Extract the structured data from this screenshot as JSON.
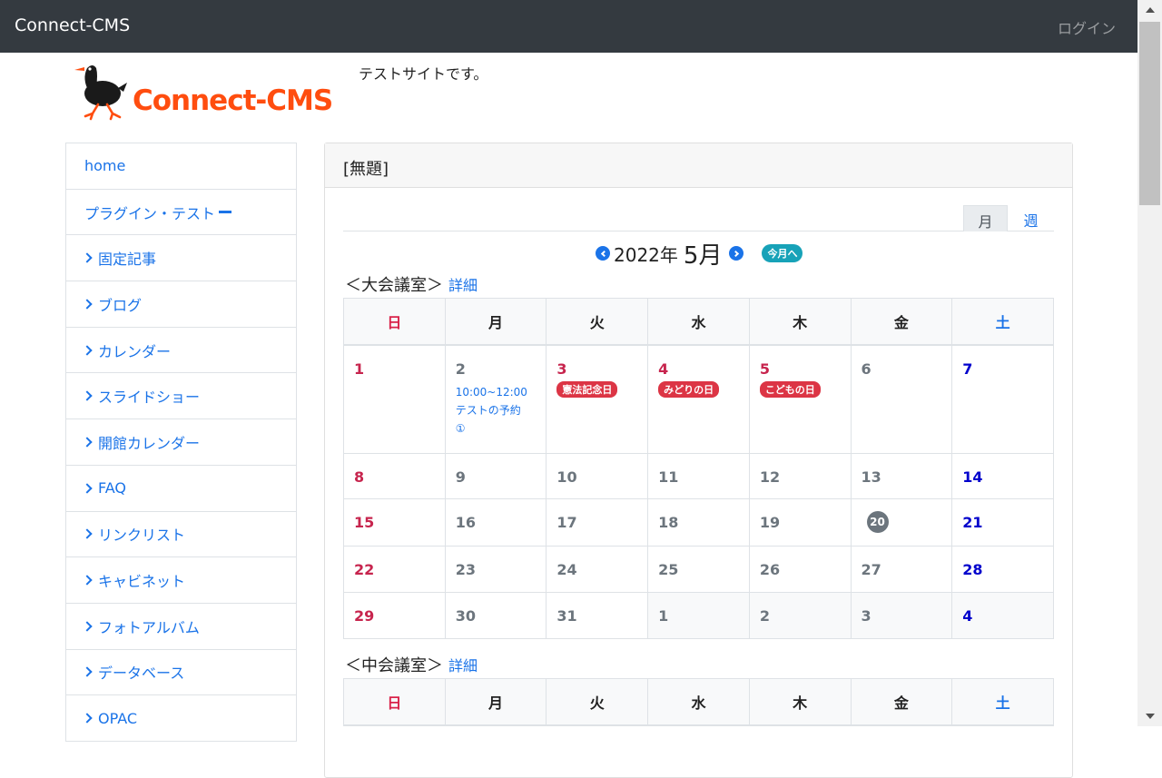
{
  "header": {
    "brand": "Connect-CMS",
    "login": "ログイン"
  },
  "site": {
    "logo_text": "Connect-CMS",
    "tagline": "テストサイトです。"
  },
  "sidebar": {
    "items": [
      {
        "label": "home"
      },
      {
        "label": "プラグイン・テスト"
      },
      {
        "label": "固定記事"
      },
      {
        "label": "ブログ"
      },
      {
        "label": "カレンダー"
      },
      {
        "label": "スライドショー"
      },
      {
        "label": "開館カレンダー"
      },
      {
        "label": "FAQ"
      },
      {
        "label": "リンクリスト"
      },
      {
        "label": "キャビネット"
      },
      {
        "label": "フォトアルバム"
      },
      {
        "label": "データベース"
      },
      {
        "label": "OPAC"
      }
    ]
  },
  "card": {
    "title": "[無題]",
    "tabs": {
      "month": "月",
      "week": "週"
    },
    "nav": {
      "year": "2022年",
      "month": "5月",
      "today_button": "今月へ"
    }
  },
  "weekdays": [
    "日",
    "月",
    "火",
    "水",
    "木",
    "金",
    "土"
  ],
  "rooms": [
    {
      "title": "＜大会議室＞",
      "detail": "詳細"
    },
    {
      "title": "＜中会議室＞",
      "detail": "詳細"
    }
  ],
  "calendar": {
    "weeks": [
      [
        "1",
        "2",
        "3",
        "4",
        "5",
        "6",
        "7"
      ],
      [
        "8",
        "9",
        "10",
        "11",
        "12",
        "13",
        "14"
      ],
      [
        "15",
        "16",
        "17",
        "18",
        "19",
        "20",
        "21"
      ],
      [
        "22",
        "23",
        "24",
        "25",
        "26",
        "27",
        "28"
      ],
      [
        "29",
        "30",
        "31",
        "1",
        "2",
        "3",
        "4"
      ]
    ],
    "holidays": {
      "kenpo": "憲法記念日",
      "midori": "みどりの日",
      "kodomo": "こどもの日"
    },
    "event": {
      "time": "10:00~12:00",
      "title": "テストの予約",
      "mark": "①"
    }
  }
}
